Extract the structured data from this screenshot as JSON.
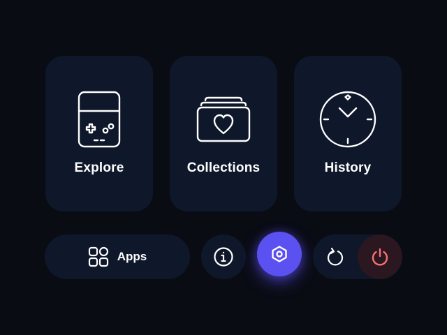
{
  "tiles": {
    "explore": {
      "label": "Explore",
      "icon": "handheld-console-icon"
    },
    "collections": {
      "label": "Collections",
      "icon": "heart-folder-icon"
    },
    "history": {
      "label": "History",
      "icon": "clock-icon"
    }
  },
  "dock": {
    "apps": {
      "label": "Apps",
      "icon": "apps-grid-icon"
    },
    "info": {
      "icon": "info-icon"
    },
    "home": {
      "icon": "hexagon-icon"
    },
    "restart": {
      "icon": "restart-icon"
    },
    "power": {
      "icon": "power-icon"
    }
  },
  "colors": {
    "background": "#0a0c14",
    "tile": "#0f172a",
    "accent": "#5b50f0",
    "power": "#f87171",
    "power_bg": "#2a1720",
    "text": "#ffffff"
  }
}
